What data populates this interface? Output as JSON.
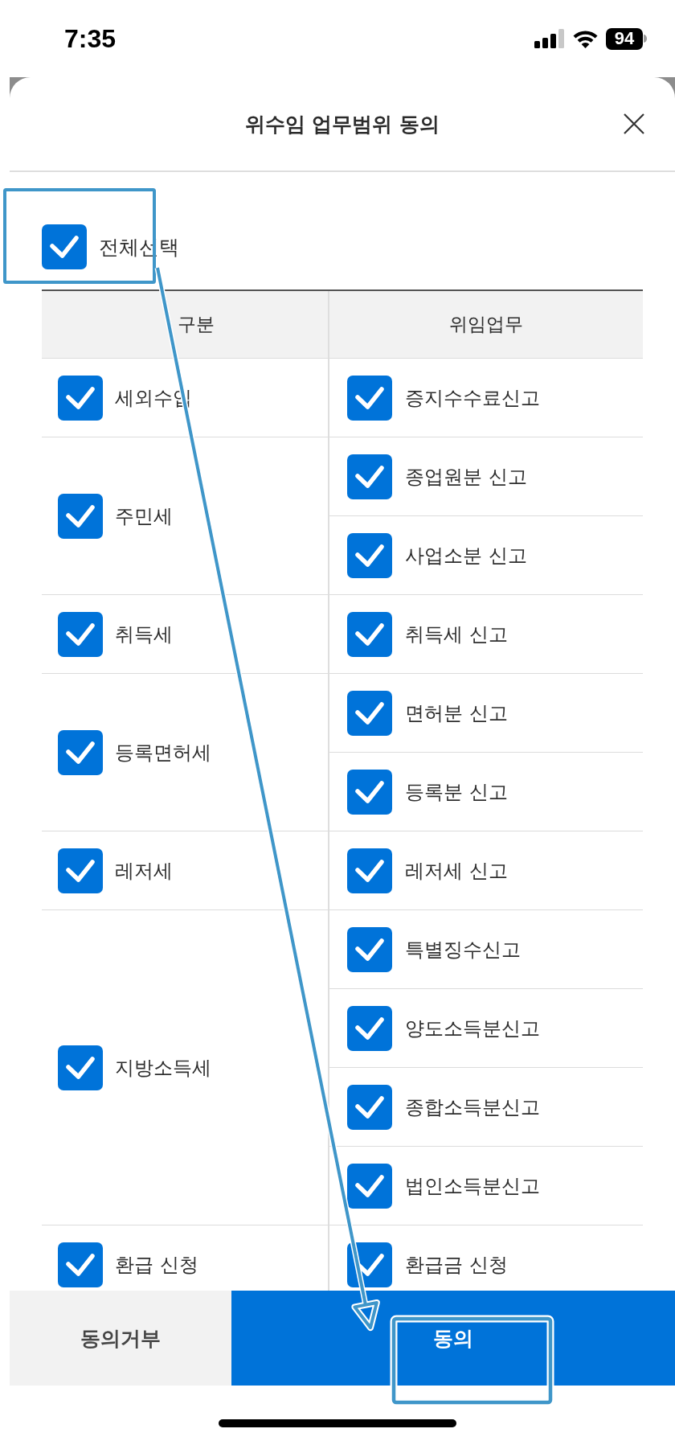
{
  "status_bar": {
    "time": "7:35",
    "battery": "94"
  },
  "sheet": {
    "title": "위수임 업무범위 동의"
  },
  "select_all": {
    "label": "전체선택",
    "checked": true
  },
  "table": {
    "columns": [
      "구분",
      "위임업무"
    ],
    "groups": [
      {
        "label": "세외수입",
        "checked": true,
        "tasks": [
          {
            "label": "증지수수료신고",
            "checked": true
          }
        ]
      },
      {
        "label": "주민세",
        "checked": true,
        "tasks": [
          {
            "label": "종업원분 신고",
            "checked": true
          },
          {
            "label": "사업소분 신고",
            "checked": true
          }
        ]
      },
      {
        "label": "취득세",
        "checked": true,
        "tasks": [
          {
            "label": "취득세 신고",
            "checked": true
          }
        ]
      },
      {
        "label": "등록면허세",
        "checked": true,
        "tasks": [
          {
            "label": "면허분 신고",
            "checked": true
          },
          {
            "label": "등록분 신고",
            "checked": true
          }
        ]
      },
      {
        "label": "레저세",
        "checked": true,
        "tasks": [
          {
            "label": "레저세 신고",
            "checked": true
          }
        ]
      },
      {
        "label": "지방소득세",
        "checked": true,
        "tasks": [
          {
            "label": "특별징수신고",
            "checked": true
          },
          {
            "label": "양도소득분신고",
            "checked": true
          },
          {
            "label": "종합소득분신고",
            "checked": true
          },
          {
            "label": "법인소득분신고",
            "checked": true
          }
        ]
      },
      {
        "label": "환급 신청",
        "checked": true,
        "tasks": [
          {
            "label": "환급금 신청",
            "checked": true
          }
        ]
      }
    ]
  },
  "buttons": [
    {
      "label": "동의거부",
      "kind": "secondary"
    },
    {
      "label": "동의",
      "kind": "primary"
    }
  ]
}
